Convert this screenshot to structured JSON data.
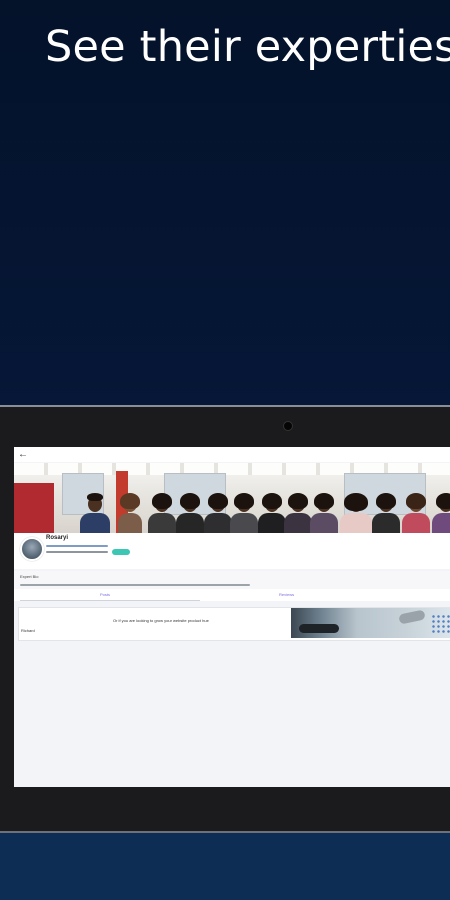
{
  "headline": "See their experties",
  "app": {
    "back_icon": "back-arrow-icon",
    "profile": {
      "name": "Rosaryi"
    },
    "bio_title": "Expert Bio",
    "tabs": [
      {
        "label": "Posts"
      },
      {
        "label": "Reviews"
      }
    ],
    "post": {
      "text": "Or if you are looking to grow your website product hue",
      "author": "Richard"
    }
  },
  "colors": {
    "background": "#04122a",
    "accent_teal": "#3cc7b4",
    "tab_purple": "#7b6ee0"
  }
}
